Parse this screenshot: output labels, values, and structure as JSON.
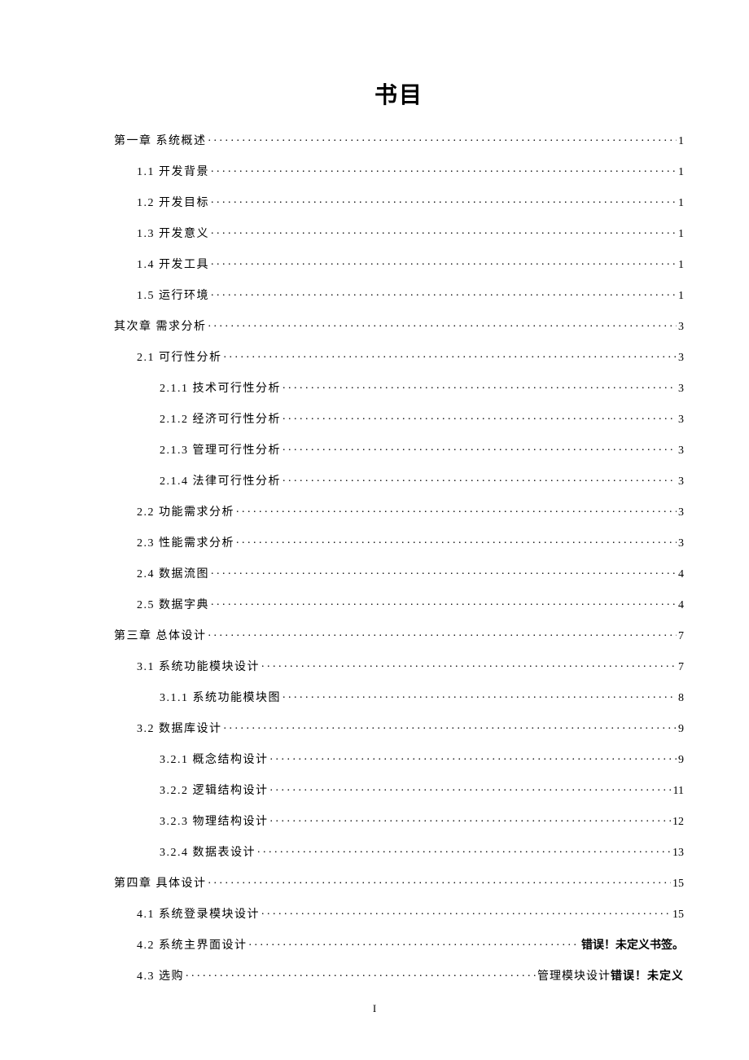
{
  "title": "书目",
  "footer_page": "I",
  "error_text_bold": "错误！未定义书签。",
  "error_text_bold2": "错误！未定义",
  "toc": [
    {
      "level": 0,
      "label": "第一章  系统概述",
      "page": "1"
    },
    {
      "level": 1,
      "label": "1.1 开发背景",
      "page": "1"
    },
    {
      "level": 1,
      "label": "1.2 开发目标",
      "page": "1"
    },
    {
      "level": 1,
      "label": "1.3 开发意义",
      "page": "1"
    },
    {
      "level": 1,
      "label": "1.4 开发工具",
      "page": "1"
    },
    {
      "level": 1,
      "label": "1.5 运行环境",
      "page": "1"
    },
    {
      "level": 0,
      "label": "其次章 需求分析",
      "page": "3"
    },
    {
      "level": 1,
      "label": "2.1 可行性分析",
      "page": "3"
    },
    {
      "level": 2,
      "label": "2.1.1 技术可行性分析",
      "page": "3"
    },
    {
      "level": 2,
      "label": "2.1.2 经济可行性分析",
      "page": "3"
    },
    {
      "level": 2,
      "label": "2.1.3 管理可行性分析 ",
      "page": "3"
    },
    {
      "level": 2,
      "label": "2.1.4 法律可行性分析",
      "page": "3"
    },
    {
      "level": 1,
      "label": "2.2 功能需求分析",
      "page": "3"
    },
    {
      "level": 1,
      "label": "2.3 性能需求分析",
      "page": "3"
    },
    {
      "level": 1,
      "label": "2.4 数据流图",
      "page": "4"
    },
    {
      "level": 1,
      "label": "2.5 数据字典",
      "page": "4"
    },
    {
      "level": 0,
      "label": "第三章  总体设计",
      "page": "7"
    },
    {
      "level": 1,
      "label": "3.1 系统功能模块设计",
      "page": "7"
    },
    {
      "level": 2,
      "label": "3.1.1 系统功能模块图",
      "page": "8"
    },
    {
      "level": 1,
      "label": "3.2 数据库设计",
      "page": "9"
    },
    {
      "level": 2,
      "label": "3.2.1 概念结构设计 ",
      "page": "9"
    },
    {
      "level": 2,
      "label": "3.2.2 逻辑结构设计",
      "page": "11"
    },
    {
      "level": 2,
      "label": "3.2.3 物理结构设计",
      "page": "12"
    },
    {
      "level": 2,
      "label": "3.2.4 数据表设计 ",
      "page": "13"
    },
    {
      "level": 0,
      "label": "第四章 具体设计",
      "page": "15"
    },
    {
      "level": 1,
      "label": "4.1 系统登录模块设计",
      "page": "15"
    },
    {
      "level": 1,
      "label": "4.2 系统主界面设计",
      "page_html": "<span class='bold'>错误！未定义书签。</span>"
    },
    {
      "level": 1,
      "label": "4.3 选购",
      "trail_html": "管理模块设计<span class='bold'>错误！未定义</span>"
    }
  ]
}
